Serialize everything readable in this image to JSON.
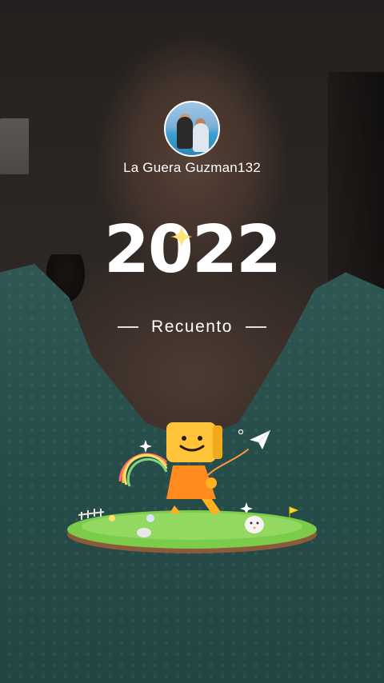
{
  "profile": {
    "username": "La Guera Guzman132",
    "avatar_icon": "profile-photo"
  },
  "recap": {
    "year": "2022",
    "subtitle": "Recuento"
  },
  "colors": {
    "text": "#ffffff",
    "sparkle": "#ffe27a",
    "mascot_head": "#ffc43a",
    "mascot_body": "#ff8a1e",
    "grass": "#7ccc4c"
  },
  "icons": {
    "year_sparkle": "sparkle-icon",
    "paper_plane": "paper-plane-icon",
    "rainbow": "rainbow-icon"
  }
}
